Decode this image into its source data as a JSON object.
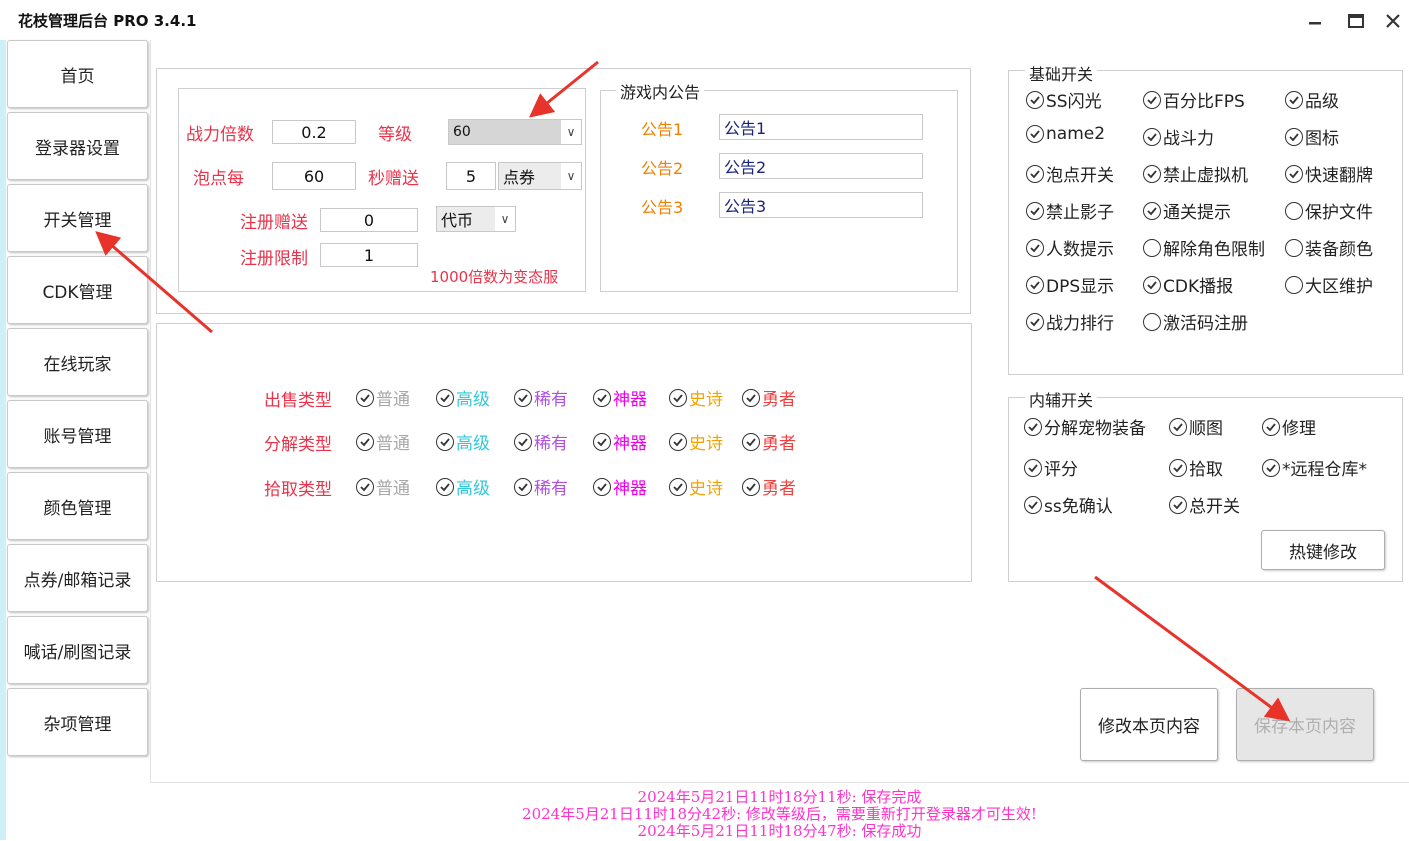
{
  "window": {
    "title": "花枝管理后台 PRO 3.4.1",
    "minimize_icon": "minimize-icon",
    "maximize_icon": "maximize-icon",
    "close_icon": "close-icon"
  },
  "sidebar": {
    "items": [
      {
        "label": "首页"
      },
      {
        "label": "登录器设置"
      },
      {
        "label": "开关管理"
      },
      {
        "label": "CDK管理"
      },
      {
        "label": "在线玩家"
      },
      {
        "label": "账号管理"
      },
      {
        "label": "颜色管理"
      },
      {
        "label": "点券/邮箱记录"
      },
      {
        "label": "喊话/刷图记录"
      },
      {
        "label": "杂项管理"
      }
    ]
  },
  "settings": {
    "power_multiplier_label": "战力倍数",
    "power_multiplier_value": "0.2",
    "level_label": "等级",
    "level_value": "60",
    "bubble_label": "泡点每",
    "bubble_value": "60",
    "seconds_gift_label": "秒赠送",
    "seconds_gift_value": "5",
    "gift_currency": "点券",
    "register_gift_label": "注册赠送",
    "register_gift_value": "0",
    "register_gift_currency": "代币",
    "register_limit_label": "注册限制",
    "register_limit_value": "1",
    "note": "1000倍数为变态服"
  },
  "announcements": {
    "title": "游戏内公告",
    "items": [
      {
        "label": "公告1",
        "value": "公告1"
      },
      {
        "label": "公告2",
        "value": "公告2"
      },
      {
        "label": "公告3",
        "value": "公告3"
      }
    ]
  },
  "item_types": {
    "rows": [
      {
        "label": "出售类型"
      },
      {
        "label": "分解类型"
      },
      {
        "label": "拾取类型"
      }
    ],
    "grades": [
      {
        "label": "普通",
        "color": "#a8a8a8"
      },
      {
        "label": "高级",
        "color": "#33c8d8"
      },
      {
        "label": "稀有",
        "color": "#b050e0"
      },
      {
        "label": "神器",
        "color": "#ee00ee"
      },
      {
        "label": "史诗",
        "color": "#f5a300"
      },
      {
        "label": "勇者",
        "color": "#f04040"
      }
    ]
  },
  "basic_switches": {
    "title": "基础开关",
    "items": [
      {
        "label": "SS闪光",
        "checked": true
      },
      {
        "label": "百分比FPS",
        "checked": true
      },
      {
        "label": "品级",
        "checked": true
      },
      {
        "label": "name2",
        "checked": true
      },
      {
        "label": "战斗力",
        "checked": true
      },
      {
        "label": "图标",
        "checked": true
      },
      {
        "label": "泡点开关",
        "checked": true
      },
      {
        "label": "禁止虚拟机",
        "checked": true
      },
      {
        "label": "快速翻牌",
        "checked": true
      },
      {
        "label": "禁止影子",
        "checked": true
      },
      {
        "label": "通关提示",
        "checked": true
      },
      {
        "label": "保护文件",
        "checked": false
      },
      {
        "label": "人数提示",
        "checked": true
      },
      {
        "label": "解除角色限制",
        "checked": false
      },
      {
        "label": "装备颜色",
        "checked": false
      },
      {
        "label": "DPS显示",
        "checked": true
      },
      {
        "label": "CDK播报",
        "checked": true
      },
      {
        "label": "大区维护",
        "checked": false
      },
      {
        "label": "战力排行",
        "checked": true
      },
      {
        "label": "激活码注册",
        "checked": false
      }
    ]
  },
  "aux_switches": {
    "title": "内辅开关",
    "items": [
      {
        "label": "分解宠物装备",
        "checked": true
      },
      {
        "label": "顺图",
        "checked": true
      },
      {
        "label": "修理",
        "checked": true
      },
      {
        "label": "评分",
        "checked": true
      },
      {
        "label": "拾取",
        "checked": true
      },
      {
        "label": "*远程仓库*",
        "checked": true
      },
      {
        "label": "ss免确认",
        "checked": true
      },
      {
        "label": "总开关",
        "checked": true
      }
    ],
    "hotkey_button": "热键修改"
  },
  "actions": {
    "modify_label": "修改本页内容",
    "save_label": "保存本页内容"
  },
  "log": {
    "lines": [
      "2024年5月21日11时18分11秒: 保存完成",
      "2024年5月21日11时18分42秒: 修改等级后，需要重新打开登录器才可生效!",
      "2024年5月21日11时18分47秒: 保存成功"
    ]
  },
  "colors": {
    "red_label": "#e8334a",
    "orange_label": "#f08000",
    "log_text": "#ff33cc",
    "annotation_arrow": "#e8332a"
  }
}
